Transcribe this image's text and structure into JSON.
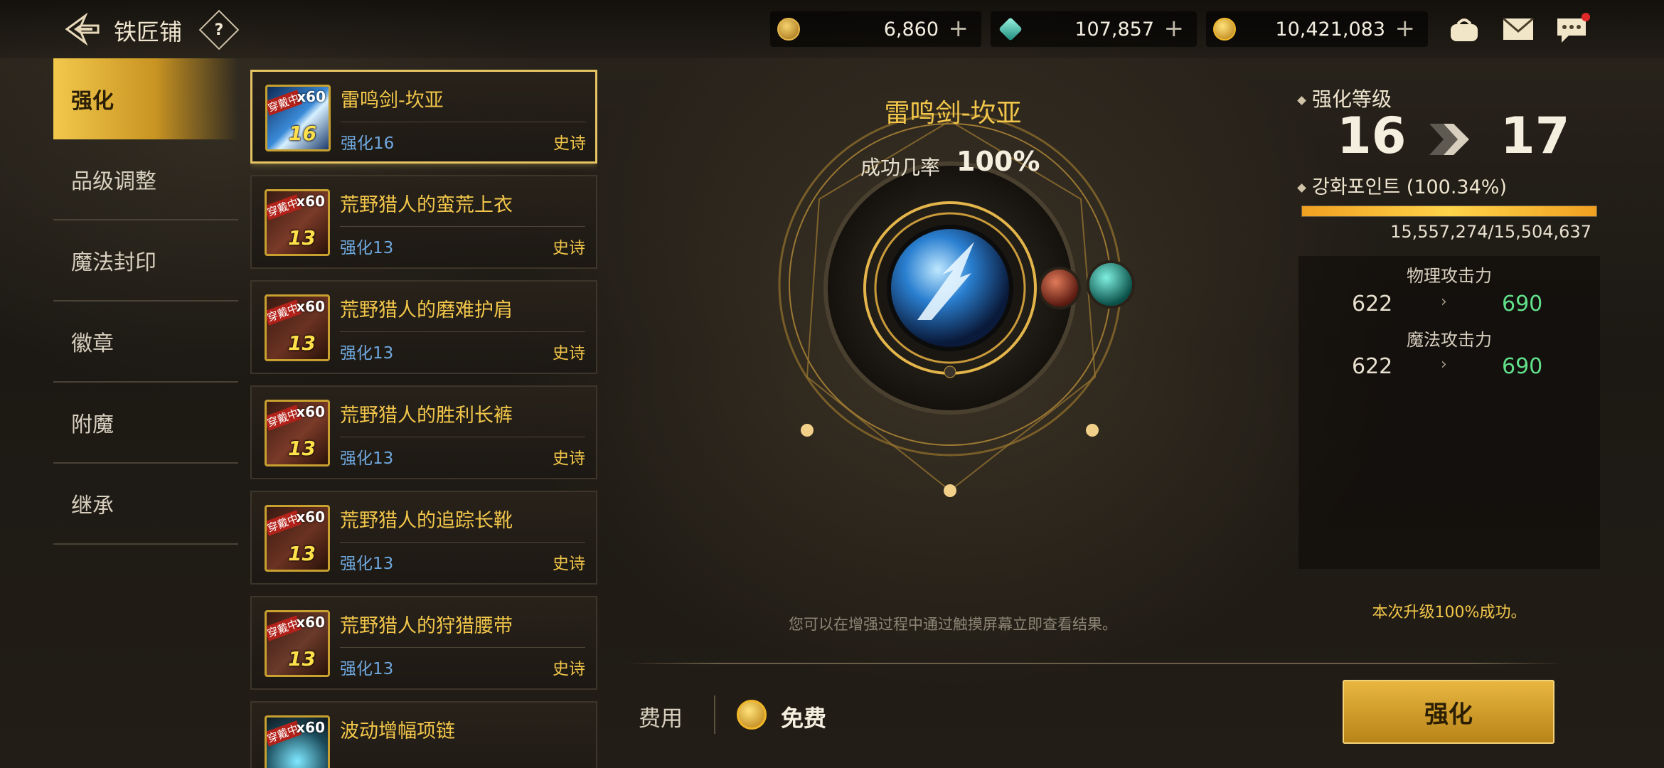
{
  "header": {
    "title": "铁匠铺",
    "help_symbol": "?",
    "currencies": [
      {
        "name": "c-coin-icon",
        "value": "6,860",
        "color": "#e6b64a"
      },
      {
        "name": "crystal-icon",
        "value": "107,857",
        "color": "#2fc9b2"
      },
      {
        "name": "gold-icon",
        "value": "10,421,083",
        "color": "#f0b628"
      }
    ],
    "plus_symbol": "+",
    "has_notification_dot": true
  },
  "menu": {
    "items": [
      {
        "label": "强化"
      },
      {
        "label": "品级调整"
      },
      {
        "label": "魔法封印"
      },
      {
        "label": "徽章"
      },
      {
        "label": "附魔"
      },
      {
        "label": "继承"
      }
    ]
  },
  "items": [
    {
      "name": "雷鸣剑-坎亚",
      "level_text": "强化16",
      "grade": "史诗",
      "icon_level": "16",
      "count": "x60",
      "tag": "穿戴中"
    },
    {
      "name": "荒野猎人的蛮荒上衣",
      "level_text": "强化13",
      "grade": "史诗",
      "icon_level": "13",
      "count": "x60",
      "tag": "穿戴中"
    },
    {
      "name": "荒野猎人的磨难护肩",
      "level_text": "强化13",
      "grade": "史诗",
      "icon_level": "13",
      "count": "x60",
      "tag": "穿戴中"
    },
    {
      "name": "荒野猎人的胜利长裤",
      "level_text": "强化13",
      "grade": "史诗",
      "icon_level": "13",
      "count": "x60",
      "tag": "穿戴中"
    },
    {
      "name": "荒野猎人的追踪长靴",
      "level_text": "强化13",
      "grade": "史诗",
      "icon_level": "13",
      "count": "x60",
      "tag": "穿戴中"
    },
    {
      "name": "荒野猎人的狩猎腰带",
      "level_text": "强化13",
      "grade": "史诗",
      "icon_level": "13",
      "count": "x60",
      "tag": "穿戴中"
    },
    {
      "name": "波动增幅项链",
      "level_text": "",
      "grade": "",
      "icon_level": "",
      "count": "x60",
      "tag": "穿戴中"
    }
  ],
  "center": {
    "item_name": "雷鸣剑-坎亚",
    "success_label": "成功几率",
    "success_rate": "100%",
    "hint": "您可以在增强过程中通过触摸屏幕立即查看结果。"
  },
  "fee": {
    "label": "费用",
    "value": "免费"
  },
  "enhance_button": "强化",
  "right_panel": {
    "level_title": "强化等级",
    "level_from": "16",
    "level_to": "17",
    "points_label": "강화포인트 (100.34%)",
    "points_fraction": 1.0,
    "points_text": "15,557,274/15,504,637",
    "stats": [
      {
        "label": "物理攻击力",
        "old": "622",
        "new": "690"
      },
      {
        "label": "魔法攻击力",
        "old": "622",
        "new": "690"
      }
    ],
    "stat_arrow": "›",
    "success_note": "本次升级100%成功。"
  }
}
